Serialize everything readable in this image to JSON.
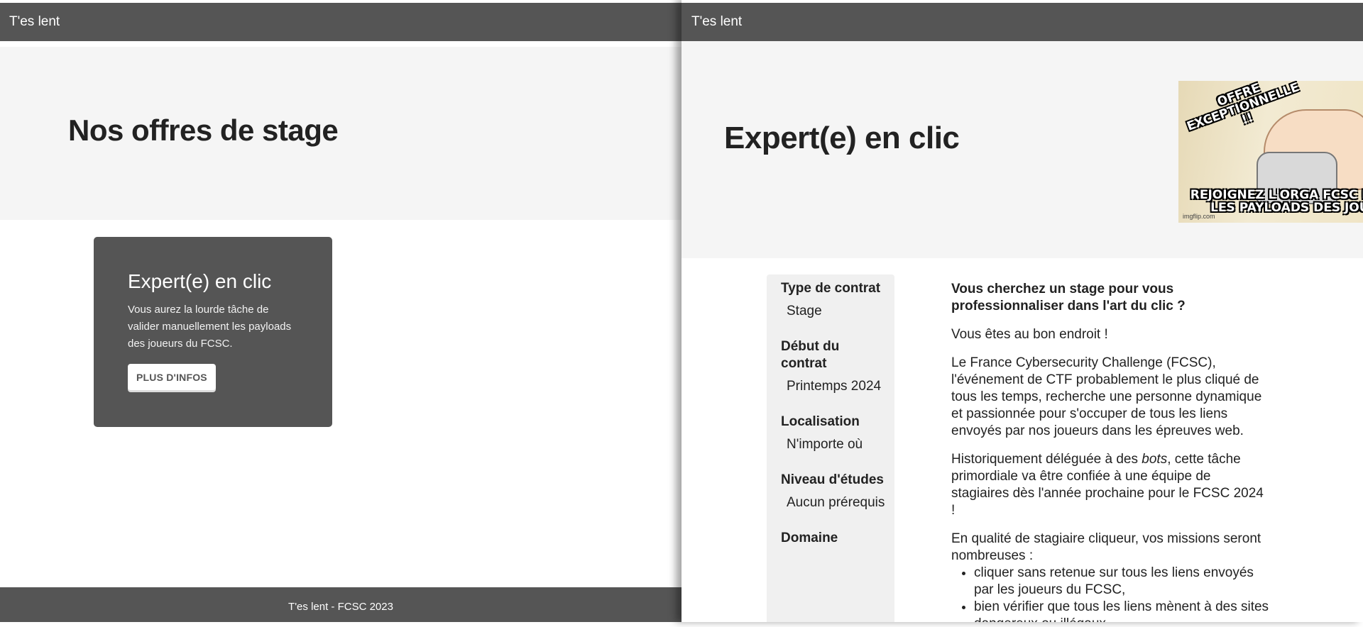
{
  "left_page": {
    "header": {
      "title": "T'es lent"
    },
    "hero": {
      "title": "Nos offres de stage"
    },
    "offer_card": {
      "title": "Expert(e) en clic",
      "description": "Vous aurez la lourde tâche de valider manuellement les payloads des joueurs du FCSC.",
      "button_label": "PLUS D'INFOS"
    },
    "footer": {
      "text": "T'es lent - FCSC 2023"
    }
  },
  "right_page": {
    "header": {
      "title": "T'es lent"
    },
    "hero": {
      "title": "Expert(e) en clic",
      "meme": {
        "caption_top": "OFFRE EXCEPTIONNELLE !!",
        "caption_bottom_1": "REJOIGNEZ L'ORGA FCSC EN V",
        "caption_bottom_2": "LES PAYLOADS DES JOUI",
        "watermark": "imgflip.com"
      }
    },
    "sidebar": {
      "fields": [
        {
          "label": "Type de contrat",
          "value": "Stage"
        },
        {
          "label": "Début du contrat",
          "value": "Printemps 2024"
        },
        {
          "label": "Localisation",
          "value": "N'importe où"
        },
        {
          "label": "Niveau d'études",
          "value": "Aucun prérequis"
        },
        {
          "label": "Domaine",
          "value": ""
        }
      ]
    },
    "content": {
      "lead": "Vous cherchez un stage pour vous professionnaliser dans l'art du clic ?",
      "p1": "Vous êtes au bon endroit !",
      "p2": "Le France Cybersecurity Challenge (FCSC), l'événement de CTF probablement le plus cliqué de tous les temps, recherche une personne dynamique et passionnée pour s'occuper de tous les liens envoyés par nos joueurs dans les épreuves web.",
      "p3_before": "Historiquement déléguée à des ",
      "p3_em": "bots",
      "p3_after": ", cette tâche primordiale va être confiée à une équipe de stagiaires dès l'année prochaine pour le FCSC 2024 !",
      "p4": "En qualité de stagiaire cliqueur, vos missions seront nombreuses :",
      "missions": [
        "cliquer sans retenue sur tous les liens envoyés par les joueurs du FCSC,",
        "bien vérifier que tous les liens mènent à des sites dangereux ou illégaux,"
      ]
    }
  }
}
